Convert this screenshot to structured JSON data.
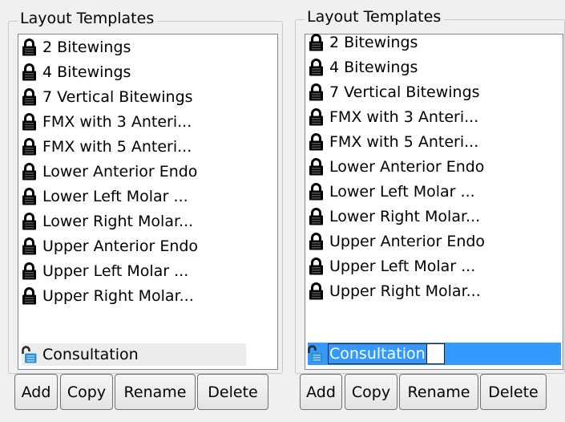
{
  "panels": [
    {
      "title": "Layout Templates",
      "items": [
        {
          "label": "2 Bitewings",
          "locked": true
        },
        {
          "label": "4 Bitewings",
          "locked": true
        },
        {
          "label": "7 Vertical Bitewings",
          "locked": true
        },
        {
          "label": "FMX with 3 Anteri...",
          "locked": true
        },
        {
          "label": "FMX with 5 Anteri...",
          "locked": true
        },
        {
          "label": "Lower Anterior Endo",
          "locked": true
        },
        {
          "label": "Lower Left Molar ...",
          "locked": true
        },
        {
          "label": "Lower Right Molar...",
          "locked": true
        },
        {
          "label": "Upper Anterior Endo",
          "locked": true
        },
        {
          "label": "Upper Left Molar ...",
          "locked": true
        },
        {
          "label": "Upper Right Molar...",
          "locked": true
        },
        {
          "label": "Consultation",
          "locked": false,
          "selected": true
        }
      ],
      "buttons": {
        "add": "Add",
        "copy": "Copy",
        "rename": "Rename",
        "delete": "Delete"
      }
    },
    {
      "title": "Layout Templates",
      "items": [
        {
          "label": "2 Bitewings",
          "locked": true
        },
        {
          "label": "4 Bitewings",
          "locked": true
        },
        {
          "label": "7 Vertical Bitewings",
          "locked": true
        },
        {
          "label": "FMX with 3 Anteri...",
          "locked": true
        },
        {
          "label": "FMX with 5 Anteri...",
          "locked": true
        },
        {
          "label": "Lower Anterior Endo",
          "locked": true
        },
        {
          "label": "Lower Left Molar ...",
          "locked": true
        },
        {
          "label": "Lower Right Molar...",
          "locked": true
        },
        {
          "label": "Upper Anterior Endo",
          "locked": true
        },
        {
          "label": "Upper Left Molar ...",
          "locked": true
        },
        {
          "label": "Upper Right Molar...",
          "locked": true
        },
        {
          "label": "Consultation",
          "locked": false,
          "selected": true,
          "editing": true
        }
      ],
      "buttons": {
        "add": "Add",
        "copy": "Copy",
        "rename": "Rename",
        "delete": "Delete"
      }
    }
  ],
  "colors": {
    "selection": "#3399ff",
    "unlocked_lock": "#2f8fd0",
    "locked_lock": "#000000"
  },
  "icons": {
    "locked": "padlock-closed-icon",
    "unlocked": "padlock-open-icon"
  }
}
